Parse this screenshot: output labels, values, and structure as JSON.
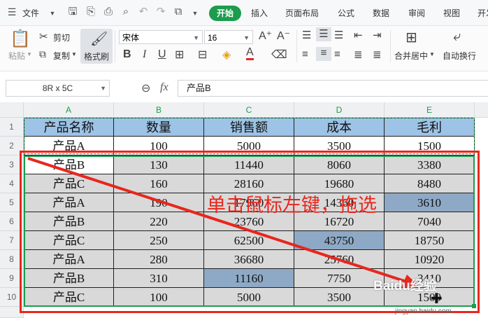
{
  "menu": {
    "file_label": "文件",
    "tabs": [
      "开始",
      "插入",
      "页面布局",
      "公式",
      "数据",
      "审阅",
      "视图",
      "开发"
    ]
  },
  "ribbon": {
    "paste_label": "粘贴",
    "cut_label": "剪切",
    "copy_label": "复制",
    "format_painter_label": "格式刷",
    "font_name": "宋体",
    "font_size": "16",
    "merge_center_label": "合并居中",
    "wrap_text_label": "自动换行"
  },
  "formula_bar": {
    "name_box": "8R x 5C",
    "fx_label": "fx",
    "formula_value": "产品B"
  },
  "sheet": {
    "columns": [
      "A",
      "B",
      "C",
      "D",
      "E"
    ],
    "rows": [
      "1",
      "2",
      "3",
      "4",
      "5",
      "6",
      "7",
      "8",
      "9",
      "10"
    ],
    "header": [
      "产品名称",
      "数量",
      "销售额",
      "成本",
      "毛利"
    ],
    "data": [
      [
        "产品A",
        "100",
        "5000",
        "3500",
        "1500"
      ],
      [
        "产品B",
        "130",
        "11440",
        "8060",
        "3380"
      ],
      [
        "产品C",
        "160",
        "28160",
        "19680",
        "8480"
      ],
      [
        "产品A",
        "190",
        "17960",
        "14360",
        "3610"
      ],
      [
        "产品B",
        "220",
        "23760",
        "16720",
        "7040"
      ],
      [
        "产品C",
        "250",
        "62500",
        "43750",
        "18750"
      ],
      [
        "产品A",
        "280",
        "36680",
        "25760",
        "10920"
      ],
      [
        "产品B",
        "310",
        "11160",
        "7750",
        "3410"
      ],
      [
        "产品C",
        "100",
        "5000",
        "3500",
        "1500"
      ]
    ]
  },
  "annotation": {
    "text": "单击鼠标左键，拖选",
    "color": "#e8261d"
  },
  "watermark": {
    "brand": "Baidu经验",
    "url": "jingyan.baidu.com"
  },
  "colors": {
    "accent": "#1c9c4c",
    "header_fill": "#9dc3e6",
    "selection_fill": "#d9d9d9",
    "highlight_fill": "#8ea9c5"
  }
}
